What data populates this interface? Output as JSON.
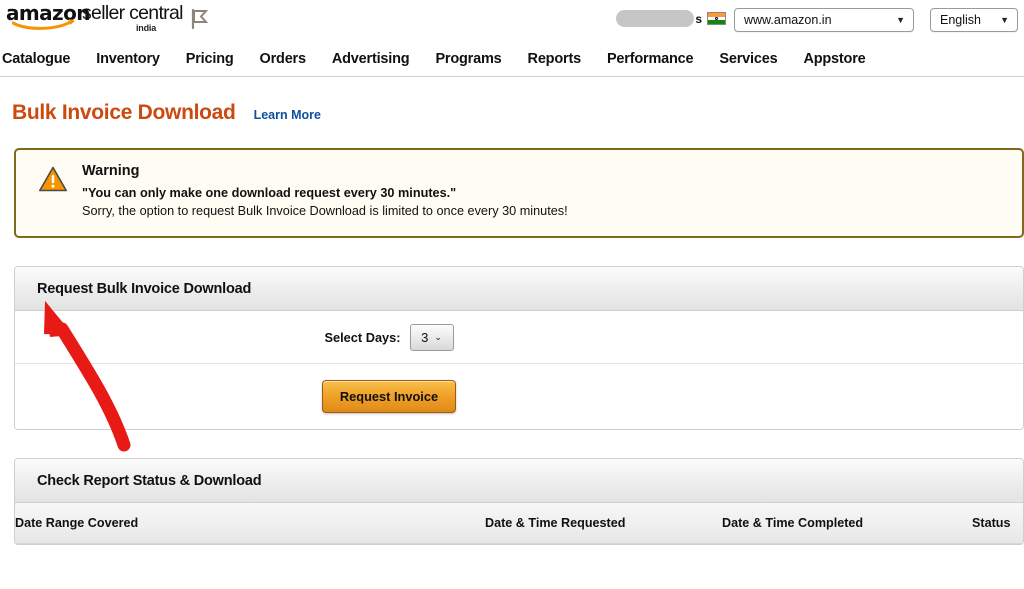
{
  "header": {
    "logo": {
      "amazon": "amazon",
      "seller_central": "seller central",
      "locale": "india"
    },
    "flag_pennant_icon": "flag-pennant-icon",
    "account_name_redacted": "s",
    "country_flag_icon": "india-flag-icon",
    "marketplace_select": {
      "value": "www.amazon.in",
      "caret": "▼"
    },
    "language_select": {
      "value": "English",
      "caret": "▼"
    }
  },
  "nav": {
    "items": [
      {
        "label": "Catalogue"
      },
      {
        "label": "Inventory"
      },
      {
        "label": "Pricing"
      },
      {
        "label": "Orders"
      },
      {
        "label": "Advertising"
      },
      {
        "label": "Programs"
      },
      {
        "label": "Reports"
      },
      {
        "label": "Performance"
      },
      {
        "label": "Services"
      },
      {
        "label": "Appstore"
      }
    ]
  },
  "page": {
    "title": "Bulk Invoice Download",
    "learn_more": "Learn More"
  },
  "warning": {
    "icon": "warning-triangle-icon",
    "title": "Warning",
    "quote": "\"You can only make one download request every 30 minutes.\"",
    "detail": "Sorry, the option to request Bulk Invoice Download is limited to once every 30 minutes!"
  },
  "request_panel": {
    "header": "Request Bulk Invoice Download",
    "select_days_label": "Select Days:",
    "select_days_value": "3",
    "select_days_caret": "⌄",
    "request_button": "Request Invoice"
  },
  "status_panel": {
    "header": "Check Report Status & Download",
    "table": {
      "columns": [
        "Date Range Covered",
        "Date & Time Requested",
        "Date & Time Completed",
        "Status"
      ],
      "rows": []
    }
  },
  "annotation": {
    "arrow_color": "#e81a16",
    "arrow_name": "red-curved-arrow-annotation"
  },
  "colors": {
    "title_orange": "#cc4a10",
    "link_blue": "#0d4fa0",
    "warning_border": "#7d6a1d",
    "warning_bg": "#fffdf3",
    "button_orange": "#f0a22a",
    "amazon_smile": "#f79400"
  }
}
